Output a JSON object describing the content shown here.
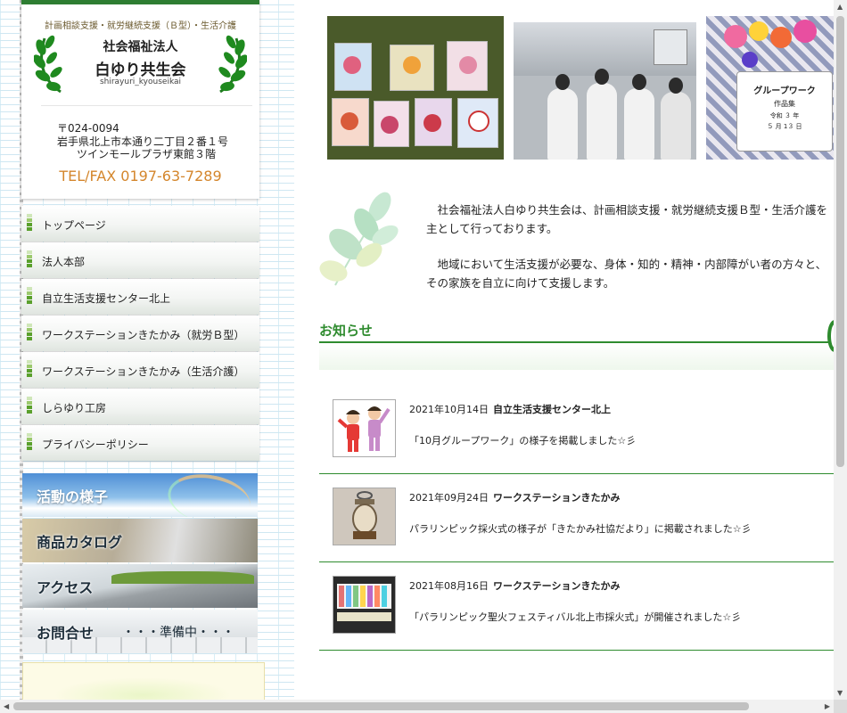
{
  "header": {
    "services": "計画相談支援・就労継続支援（Ｂ型）・生活介護",
    "org_type": "社会福祉法人",
    "org_name": "白ゆり共生会",
    "org_roman": "shirayuri_kyouseikai",
    "postal": "〒024-0094",
    "address1": "岩手県北上市本通り二丁目２番１号",
    "address2": "ツインモールプラザ東館３階",
    "tel": "TEL/FAX 0197-63-7289"
  },
  "nav": {
    "items": [
      {
        "label": "トップページ"
      },
      {
        "label": "法人本部"
      },
      {
        "label": "自立生活支援センター北上"
      },
      {
        "label": "ワークステーションきたかみ（就労Ｂ型）"
      },
      {
        "label": "ワークステーションきたかみ（生活介護）"
      },
      {
        "label": "しらゆり工房"
      },
      {
        "label": "プライバシーポリシー"
      }
    ]
  },
  "banners": {
    "activities": "活動の様子",
    "catalog": "商品カタログ",
    "access": "アクセス",
    "contact": "お問合せ",
    "contact_note": "・・・準備中・・・"
  },
  "photos": {
    "group_work_card_title": "グループワーク",
    "group_work_card_sub": "作品集",
    "group_work_card_date1": "令和 ３ 年",
    "group_work_card_date2": "５ 月 1３ 日"
  },
  "intro": {
    "p1_line1": "　社会福祉法人白ゆり共生会は、計画相談支援・就労継続支援Ｂ型・生活介護を",
    "p1_line2": "主として行っております。",
    "p2_line1": "　地域において生活支援が必要な、身体・知的・精神・内部障がい者の方々と、",
    "p2_line2": "その家族を自立に向けて支援します。"
  },
  "news": {
    "title": "お知らせ",
    "items": [
      {
        "date": "2021年10月14日",
        "org": "自立生活支援センター北上",
        "text": "「10月グループワーク」の様子を掲載しました☆彡"
      },
      {
        "date": "2021年09月24日",
        "org": "ワークステーションきたかみ",
        "text": "パラリンピック採火式の様子が「きたかみ社協だより」に掲載されました☆彡"
      },
      {
        "date": "2021年08月16日",
        "org": "ワークステーションきたかみ",
        "text": "「パラリンピック聖火フェスティバル北上市採火式」が開催されました☆彡"
      }
    ]
  },
  "colors": {
    "brand_green": "#2e7d32",
    "news_green": "#2e8b2e",
    "tel_orange": "#d4862c"
  }
}
